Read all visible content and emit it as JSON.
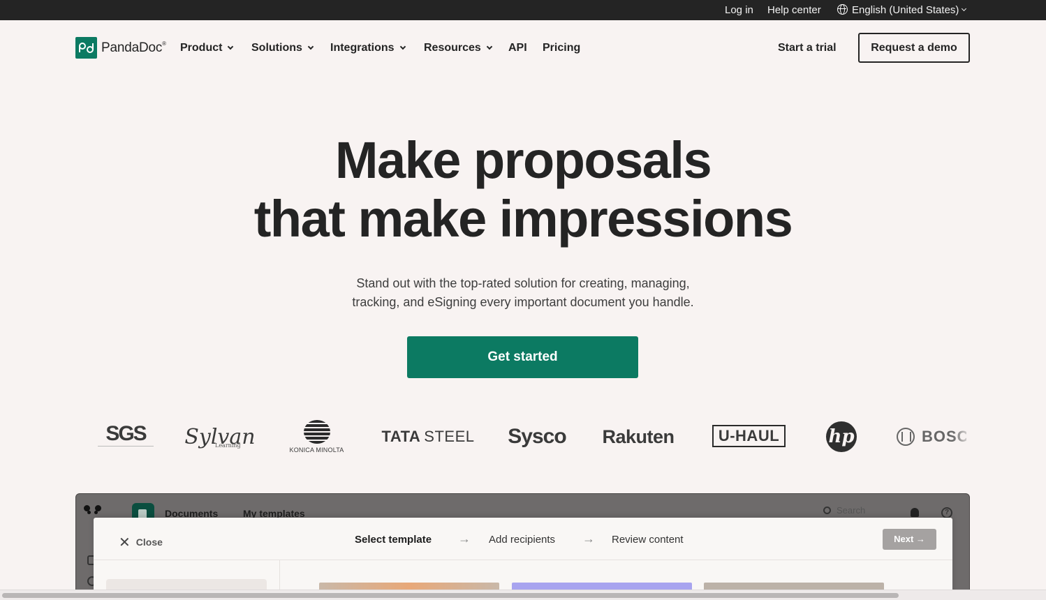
{
  "topbar": {
    "login": "Log in",
    "help": "Help center",
    "language": "English (United States)"
  },
  "nav": {
    "brand": "PandaDoc",
    "items": [
      "Product",
      "Solutions",
      "Integrations",
      "Resources",
      "API",
      "Pricing"
    ],
    "start_trial": "Start a trial",
    "request_demo": "Request a demo"
  },
  "hero": {
    "title_line1": "Make proposals",
    "title_line2": "that make impressions",
    "subtitle_line1": "Stand out with the top-rated solution for creating, managing,",
    "subtitle_line2": "tracking, and eSigning every important document you handle.",
    "cta": "Get started"
  },
  "logos": {
    "sgs": "SGS",
    "sylvan": "Sylvan",
    "sylvan_sub": "Learning",
    "konica": "KONICA MINOLTA",
    "tata_bold": "TATA",
    "tata_thin": "STEEL",
    "sysco": "Sysco",
    "rakuten": "Rakuten",
    "uhaul": "U-HAUL",
    "hp": "hp",
    "bosch": "BOSCH"
  },
  "app": {
    "tabs": [
      "Documents",
      "My templates"
    ],
    "search_placeholder": "Search",
    "modal": {
      "close": "Close",
      "steps": [
        "Select template",
        "Add recipients",
        "Review content"
      ],
      "next": "Next"
    }
  },
  "colors": {
    "brand_green": "#0c7a62",
    "background": "#f8f3f2",
    "topbar": "#242424"
  }
}
